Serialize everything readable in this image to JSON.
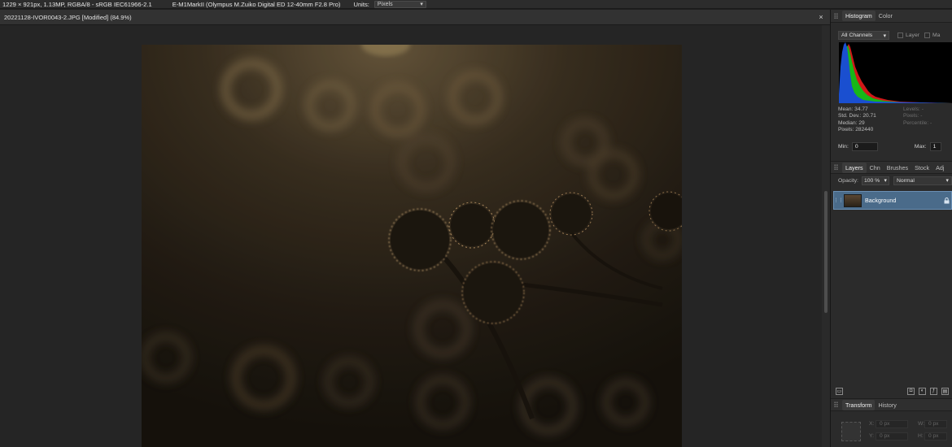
{
  "context_bar": {
    "image_info": "1229 × 921px, 1.13MP, RGBA/8 - sRGB IEC61966-2.1",
    "camera_info": "E-M1MarkII (Olympus M.Zuiko Digital ED 12-40mm F2.8 Pro)",
    "units_label": "Units:",
    "units_value": "Pixels"
  },
  "document": {
    "tab_title": "20221128-IVOR0043-2.JPG [Modified] (84.9%)",
    "close_glyph": "×"
  },
  "histogram_panel": {
    "tabs": [
      "Histogram",
      "Color"
    ],
    "channel": "All Channels",
    "layer_label": "Layer",
    "marquee_label": "Ma",
    "stats_left": [
      {
        "label": "Mean:",
        "value": "34.77"
      },
      {
        "label": "Std. Dev.:",
        "value": "20.71"
      },
      {
        "label": "Median:",
        "value": "29"
      },
      {
        "label": "Pixels:",
        "value": "282440"
      }
    ],
    "stats_right": [
      {
        "label": "Levels:",
        "value": "-"
      },
      {
        "label": "Pixels:",
        "value": "-"
      },
      {
        "label": "Percentile:",
        "value": "-"
      }
    ],
    "min_label": "Min:",
    "min_value": "0",
    "max_label": "Max:",
    "max_value": "1"
  },
  "layers_panel": {
    "tabs": [
      "Layers",
      "Chn",
      "Brushes",
      "Stock",
      "Adj"
    ],
    "opacity_label": "Opacity:",
    "opacity_value": "100 %",
    "blend_mode": "Normal",
    "layers": [
      {
        "name": "Background",
        "locked": true,
        "selected": true
      }
    ]
  },
  "transform_panel": {
    "tabs": [
      "Transform",
      "History"
    ],
    "fields": [
      {
        "label": "X:",
        "value": "0 px"
      },
      {
        "label": "W:",
        "value": "0 px"
      },
      {
        "label": "Y:",
        "value": "0 px"
      },
      {
        "label": "H:",
        "value": "0 px"
      }
    ]
  },
  "colors": {
    "accent_selection": "#4a6b8a",
    "histogram_blue": "#1a4fd0",
    "histogram_green": "#18b818",
    "histogram_red": "#d01818"
  }
}
